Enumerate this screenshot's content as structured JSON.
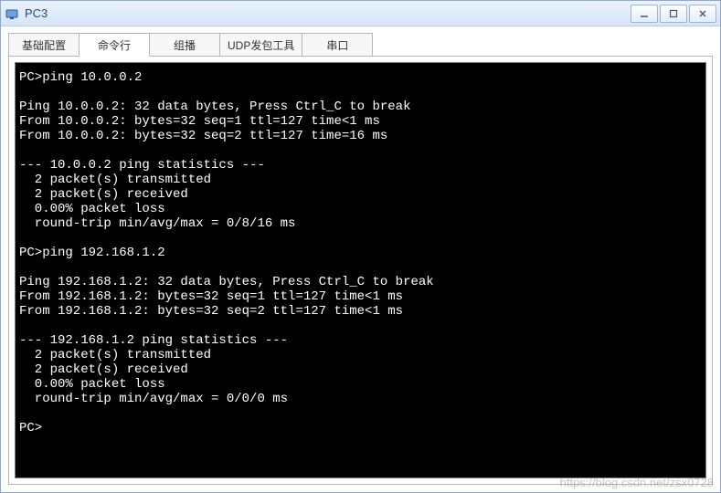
{
  "window": {
    "title": "PC3"
  },
  "tabs": {
    "items": [
      {
        "label": "基础配置"
      },
      {
        "label": "命令行"
      },
      {
        "label": "组播"
      },
      {
        "label": "UDP发包工具"
      },
      {
        "label": "串口"
      }
    ]
  },
  "terminal": {
    "lines": "PC>ping 10.0.0.2\n\nPing 10.0.0.2: 32 data bytes, Press Ctrl_C to break\nFrom 10.0.0.2: bytes=32 seq=1 ttl=127 time<1 ms\nFrom 10.0.0.2: bytes=32 seq=2 ttl=127 time=16 ms\n\n--- 10.0.0.2 ping statistics ---\n  2 packet(s) transmitted\n  2 packet(s) received\n  0.00% packet loss\n  round-trip min/avg/max = 0/8/16 ms\n\nPC>ping 192.168.1.2\n\nPing 192.168.1.2: 32 data bytes, Press Ctrl_C to break\nFrom 192.168.1.2: bytes=32 seq=1 ttl=127 time<1 ms\nFrom 192.168.1.2: bytes=32 seq=2 ttl=127 time<1 ms\n\n--- 192.168.1.2 ping statistics ---\n  2 packet(s) transmitted\n  2 packet(s) received\n  0.00% packet loss\n  round-trip min/avg/max = 0/0/0 ms\n\nPC>"
  },
  "watermark": "https://blog.csdn.net/zsx0728"
}
